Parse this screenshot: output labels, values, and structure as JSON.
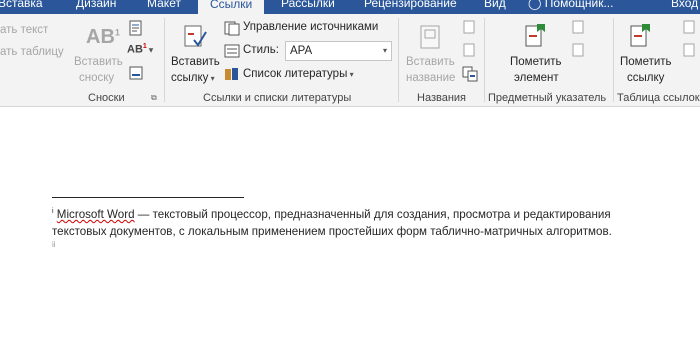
{
  "tabs": [
    "Вставка",
    "Дизайн",
    "Макет",
    "Ссылки",
    "Рассылки",
    "Рецензирование",
    "Вид",
    "Помощник...",
    "Вход"
  ],
  "active_tab_index": 3,
  "ribbon": {
    "snoski": {
      "partial_top": "ать текст",
      "partial_bottom": "ать таблицу",
      "insert_label_1": "Вставить",
      "insert_label_2": "сноску",
      "group_label": "Сноски"
    },
    "citations": {
      "insert_label_1": "Вставить",
      "insert_label_2": "ссылку",
      "manage_sources": "Управление источниками",
      "style_label": "Стиль:",
      "style_value": "APA",
      "bibliography": "Список литературы",
      "group_label": "Ссылки и списки литературы"
    },
    "captions": {
      "insert_label_1": "Вставить",
      "insert_label_2": "название",
      "group_label": "Названия"
    },
    "index": {
      "mark_label_1": "Пометить",
      "mark_label_2": "элемент",
      "group_label": "Предметный указатель"
    },
    "toa": {
      "mark_label_1": "Пометить",
      "mark_label_2": "ссылку",
      "group_label": "Таблица ссылок"
    }
  },
  "document": {
    "footnote_marker": "i",
    "footnote_term": "Microsoft Word",
    "footnote_line1_rest": " — текстовый процессор, предназначенный для создания, просмотра и редактирования",
    "footnote_line2": "текстовых документов, с локальным применением простейших форм таблично-матричных алгоритмов.",
    "second_marker": "ii"
  }
}
